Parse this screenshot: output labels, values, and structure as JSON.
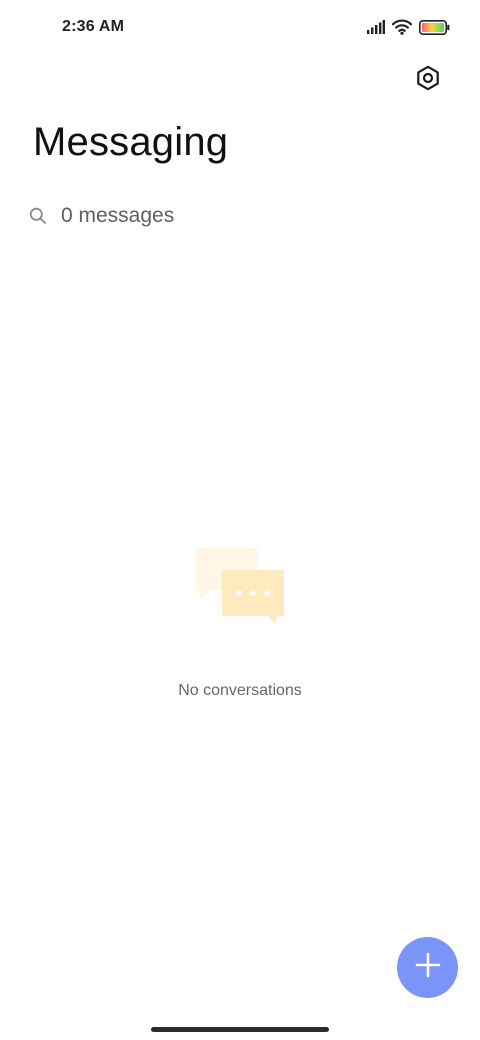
{
  "status_bar": {
    "time": "2:36 AM",
    "icons": [
      "signal-icon",
      "wifi-icon",
      "battery-icon"
    ]
  },
  "header": {
    "title": "Messaging",
    "settings_icon": "settings-icon"
  },
  "search": {
    "placeholder": "0 messages",
    "icon": "search-icon"
  },
  "empty_state": {
    "illustration": "chat-bubbles-icon",
    "message": "No conversations"
  },
  "fab": {
    "icon": "plus-icon"
  },
  "colors": {
    "accent": "#7b94f7",
    "bubble_back": "#fff6e6",
    "bubble_front": "#ffe9bd",
    "title": "#111111",
    "muted_text": "#666666"
  }
}
